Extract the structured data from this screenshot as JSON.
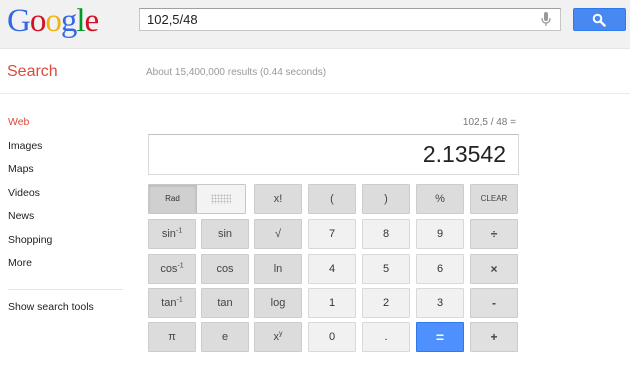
{
  "header": {
    "logo_letters": [
      "G",
      "o",
      "o",
      "g",
      "l",
      "e"
    ],
    "logo_colors": [
      "#3369e8",
      "#d50f25",
      "#eeb211",
      "#3369e8",
      "#009925",
      "#d50f25"
    ],
    "search_value": "102,5/48",
    "search_button_icon": "magnifier-icon",
    "mic_icon": "microphone-icon"
  },
  "subhead": {
    "title": "Search",
    "results_count": "About 15,400,000 results (0.44 seconds)"
  },
  "nav": {
    "items": [
      "Web",
      "Images",
      "Maps",
      "Videos",
      "News",
      "Shopping",
      "More"
    ],
    "active": "Web",
    "tools_link": "Show search tools"
  },
  "calculator": {
    "expression": "102,5 / 48 =",
    "result": "2.13542",
    "mode_rad": "Rad",
    "keys": {
      "fact": "x!",
      "lparen": "(",
      "rparen": ")",
      "percent": "%",
      "clear": "CLEAR",
      "sin_inv": "sin",
      "sin": "sin",
      "sqrt": "√",
      "seven": "7",
      "eight": "8",
      "nine": "9",
      "divide": "÷",
      "cos_inv": "cos",
      "cos": "cos",
      "ln": "ln",
      "four": "4",
      "five": "5",
      "six": "6",
      "multiply": "×",
      "tan_inv": "tan",
      "tan": "tan",
      "log": "log",
      "one": "1",
      "two": "2",
      "three": "3",
      "minus": "-",
      "pi": "π",
      "e": "e",
      "pow": "x",
      "zero": "0",
      "dot": ".",
      "equals": "=",
      "plus": "+"
    },
    "inverse_sup": "-1",
    "pow_sup": "y",
    "accent_color": "#4d90fe"
  }
}
